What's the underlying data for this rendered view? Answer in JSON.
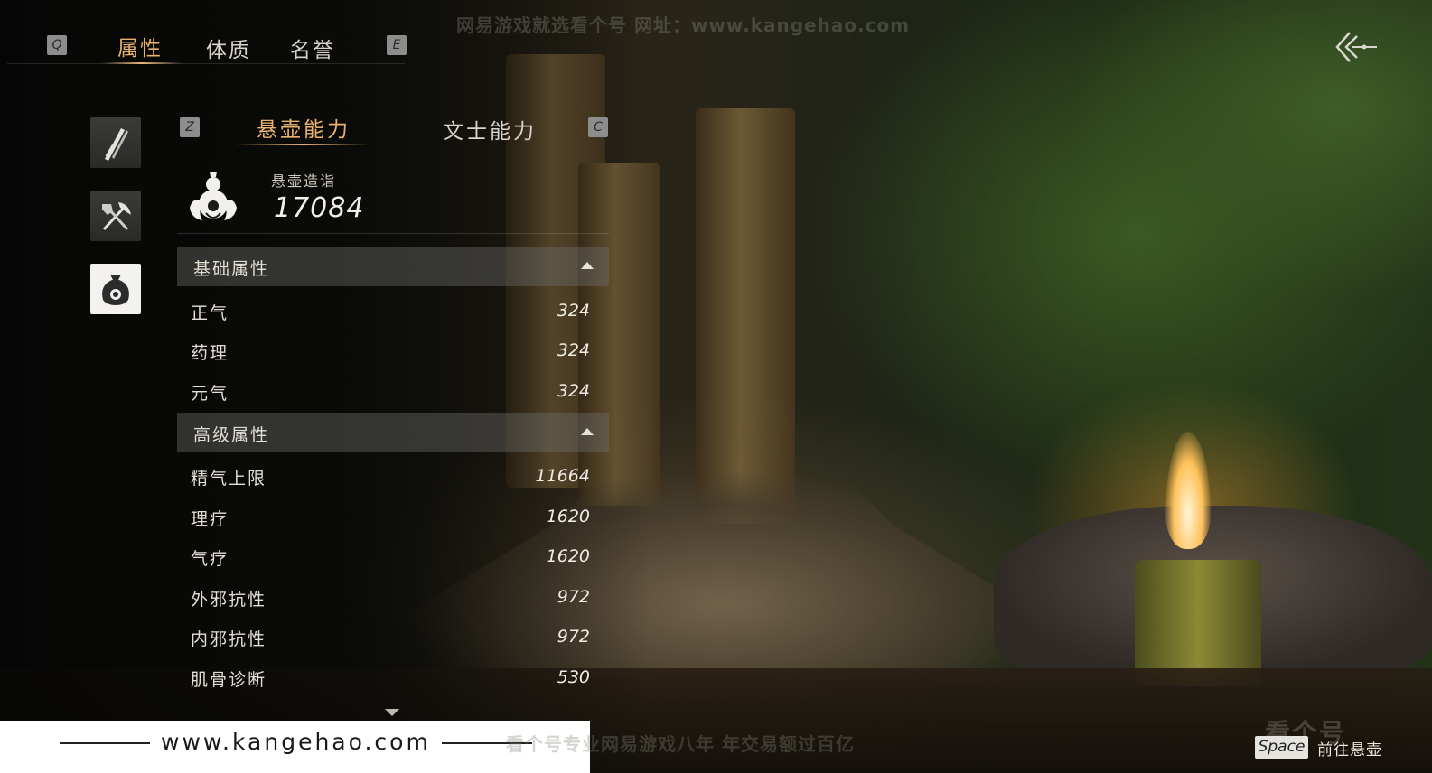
{
  "top_tabs": {
    "prev_key": "Q",
    "next_key": "E",
    "items": [
      {
        "label": "属性",
        "active": true
      },
      {
        "label": "体质",
        "active": false
      },
      {
        "label": "名誉",
        "active": false
      }
    ]
  },
  "watermarks": {
    "top": "网易游戏就选看个号  网址：www.kangehao.com",
    "bottom": "看个号专业网易游戏八年  年交易额过百亿",
    "bottom_site": "www.kangehao.com",
    "logo_text": "看个号"
  },
  "side_icons": [
    {
      "icon": "weapon-icon",
      "active": false
    },
    {
      "icon": "tools-icon",
      "active": false
    },
    {
      "icon": "medicine-pouch-icon",
      "active": true
    }
  ],
  "sub_tabs": {
    "prev_key": "Z",
    "next_key": "C",
    "items": [
      {
        "label": "悬壶能力",
        "active": true
      },
      {
        "label": "文士能力",
        "active": false
      }
    ]
  },
  "score": {
    "icon": "gourd-icon",
    "label": "悬壶造诣",
    "value": "17084"
  },
  "sections": [
    {
      "title": "基础属性",
      "rows": [
        {
          "name": "正气",
          "value": "324"
        },
        {
          "name": "药理",
          "value": "324"
        },
        {
          "name": "元气",
          "value": "324"
        }
      ]
    },
    {
      "title": "高级属性",
      "rows": [
        {
          "name": "精气上限",
          "value": "11664"
        },
        {
          "name": "理疗",
          "value": "1620"
        },
        {
          "name": "气疗",
          "value": "1620"
        },
        {
          "name": "外邪抗性",
          "value": "972"
        },
        {
          "name": "内邪抗性",
          "value": "972"
        },
        {
          "name": "肌骨诊断",
          "value": "530"
        }
      ]
    }
  ],
  "footer": {
    "key": "Space",
    "label": "前往悬壶"
  },
  "colors": {
    "accent": "#e9b26e",
    "section_bg": "#6e6e6c",
    "text": "#e4dfd6"
  }
}
